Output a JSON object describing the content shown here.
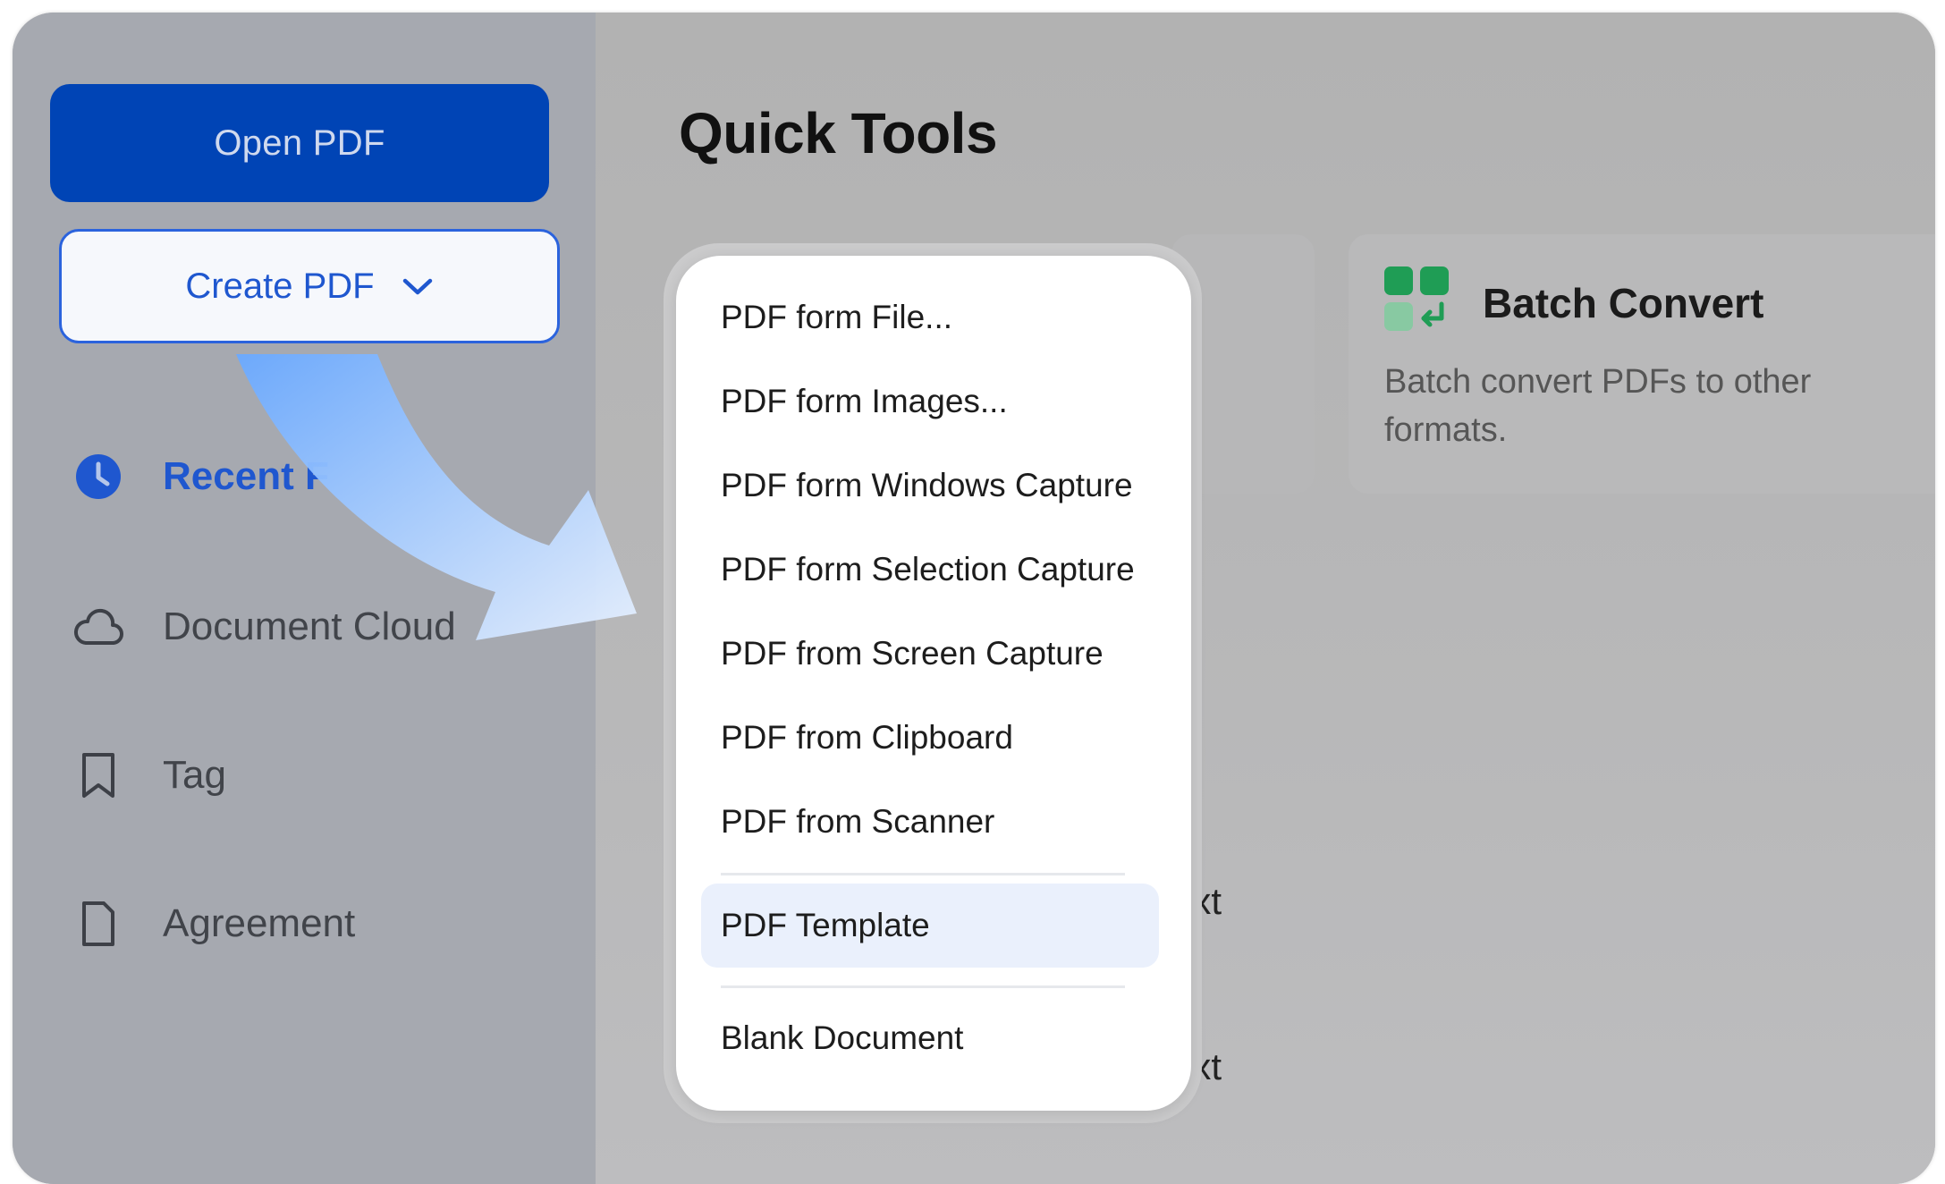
{
  "sidebar": {
    "open_pdf_label": "Open PDF",
    "create_pdf_label": "Create PDF",
    "items": [
      {
        "label": "Recent F",
        "icon": "clock-icon"
      },
      {
        "label": "Document Cloud",
        "icon": "cloud-icon"
      },
      {
        "label": "Tag",
        "icon": "bookmark-icon"
      },
      {
        "label": "Agreement",
        "icon": "document-icon"
      }
    ]
  },
  "main": {
    "title": "Quick Tools",
    "batch_card": {
      "title": "Batch Convert",
      "description": "Batch convert PDFs to other formats.",
      "icon": "batch-convert-icon"
    },
    "obscured_text_1": "ext",
    "obscured_text_2": "ext"
  },
  "dropdown": {
    "items": [
      "PDF form File...",
      "PDF form Images...",
      "PDF form Windows Capture",
      "PDF form Selection Capture",
      "PDF from Screen Capture",
      "PDF from Clipboard",
      "PDF from Scanner"
    ],
    "highlighted_item": "PDF Template",
    "last_item": "Blank Document"
  },
  "colors": {
    "accent": "#0044b5",
    "link_blue": "#1f57cf",
    "batch_icon_green": "#1f9d55",
    "highlight_bg": "#eaf0fc"
  }
}
